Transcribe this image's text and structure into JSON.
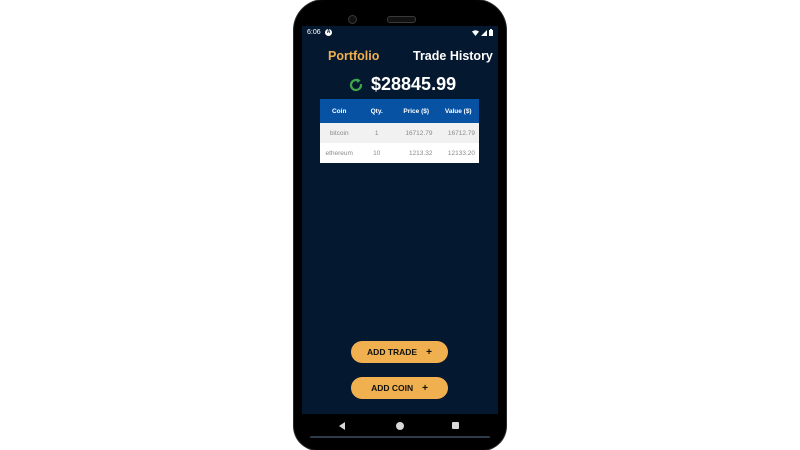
{
  "status_bar": {
    "time": "6:06",
    "notification_glyph": "A",
    "icons": [
      "wifi-icon",
      "signal-icon",
      "battery-icon"
    ]
  },
  "tabs": [
    {
      "label": "Portfolio",
      "active": true,
      "color": "#f1b04f"
    },
    {
      "label": "Trade History",
      "active": false,
      "color": "#ffffff"
    }
  ],
  "portfolio": {
    "total_value": "$28845.99",
    "refresh_icon": "refresh-icon",
    "refresh_color": "#3fa94a"
  },
  "table": {
    "headers": [
      "Coin",
      "Qty.",
      "Price ($)",
      "Value ($)"
    ],
    "rows": [
      {
        "coin": "bitcoin",
        "qty": "1",
        "price": "16712.79",
        "value": "16712.79"
      },
      {
        "coin": "ethereum",
        "qty": "10",
        "price": "1213.32",
        "value": "12133.20"
      }
    ]
  },
  "actions": {
    "add_trade_label": "ADD TRADE",
    "add_coin_label": "ADD COIN",
    "plus_glyph": "+"
  },
  "colors": {
    "background": "#041830",
    "accent": "#f1b04f",
    "table_header": "#0752a3"
  }
}
